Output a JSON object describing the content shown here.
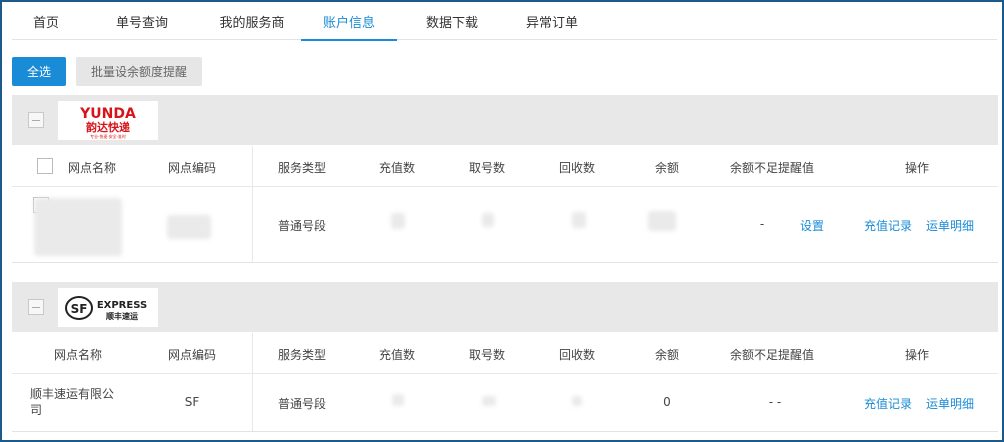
{
  "tabs": [
    {
      "label": "首页"
    },
    {
      "label": "单号查询"
    },
    {
      "label": "我的服务商"
    },
    {
      "label": "账户信息"
    },
    {
      "label": "数据下载"
    },
    {
      "label": "异常订单"
    }
  ],
  "active_tab": "账户信息",
  "toolbar": {
    "select_all": "全选",
    "batch_alert": "批量设余额度提醒"
  },
  "columns": {
    "outlet_name": "网点名称",
    "outlet_code": "网点编码",
    "service_type": "服务类型",
    "recharge": "充值数",
    "taken": "取号数",
    "recycled": "回收数",
    "balance": "余额",
    "low_alert": "余额不足提醒值",
    "actions": "操作"
  },
  "carriers": [
    {
      "logo_text": "YUNDA",
      "logo_cn": "韵达快递",
      "logo_slogan": "专业·快速·安全·准时",
      "logo_color": "#d7141a",
      "row": {
        "service_type": "普通号段",
        "low_alert": "-",
        "set_link": "设置",
        "recharge_link": "充值记录",
        "waybill_link": "运单明细"
      }
    },
    {
      "logo_text": "EXPRESS",
      "logo_sf": "SF",
      "logo_cn": "顺丰速运",
      "logo_color": "#222222",
      "row": {
        "outlet_name": "顺丰速运有限公司",
        "outlet_code": "SF",
        "service_type": "普通号段",
        "balance": "0",
        "low_alert": "- -",
        "recharge_link": "充值记录",
        "waybill_link": "运单明细"
      }
    }
  ],
  "colors": {
    "accent": "#1a8bd6",
    "frame": "#1d5a8c",
    "section_head": "#e8e8e8"
  }
}
